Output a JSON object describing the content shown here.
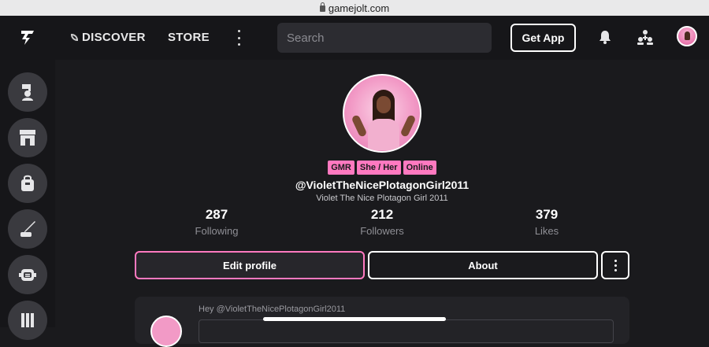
{
  "browser": {
    "url": "gamejolt.com"
  },
  "nav": {
    "discover_label": "DISCOVER",
    "store_label": "STORE",
    "search_placeholder": "Search",
    "get_app_label": "Get App"
  },
  "sidebar": {
    "items": [
      {
        "icon": "trophy-person-icon"
      },
      {
        "icon": "store-icon"
      },
      {
        "icon": "bag-icon"
      },
      {
        "icon": "quill-icon"
      },
      {
        "icon": "robot-icon"
      },
      {
        "icon": "library-icon"
      }
    ]
  },
  "profile": {
    "tags": [
      "GMR",
      "She / Her",
      "Online"
    ],
    "username": "@VioletTheNicePlotagonGirl2011",
    "display_name": "Violet The Nice Plotagon Girl 2011",
    "stats": {
      "following": {
        "value": "287",
        "label": "Following"
      },
      "followers": {
        "value": "212",
        "label": "Followers"
      },
      "likes": {
        "value": "379",
        "label": "Likes"
      }
    },
    "edit_profile_label": "Edit profile",
    "about_label": "About"
  },
  "post_prompt": "Hey @VioletTheNicePlotagonGirl2011",
  "colors": {
    "accent": "#ff79c0",
    "background": "#1a1a1d",
    "nav": "#161619"
  }
}
